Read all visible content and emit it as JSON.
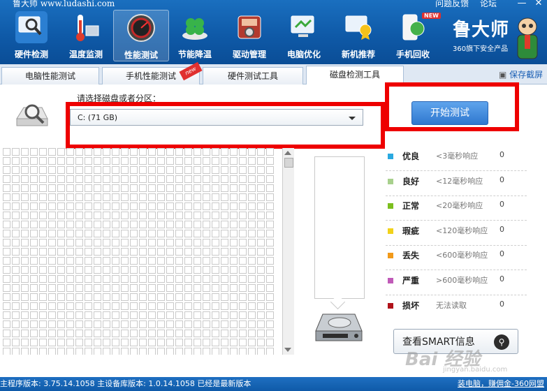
{
  "app": {
    "title": "鲁大师 www.ludashi.com",
    "top_links": [
      "问题反馈",
      "论坛"
    ],
    "window_controls": [
      "minimize",
      "close"
    ]
  },
  "nav": {
    "items": [
      {
        "label": "硬件检测",
        "icon": "monitor-magnifier-icon",
        "active": false
      },
      {
        "label": "温度监测",
        "icon": "thermometer-icon",
        "active": false
      },
      {
        "label": "性能测试",
        "icon": "speedometer-icon",
        "active": true
      },
      {
        "label": "节能降温",
        "icon": "clover-icon",
        "active": false
      },
      {
        "label": "驱动管理",
        "icon": "driver-gear-icon",
        "active": false
      },
      {
        "label": "电脑优化",
        "icon": "pc-optimize-icon",
        "active": false
      },
      {
        "label": "新机推荐",
        "icon": "award-pc-icon",
        "active": false
      },
      {
        "label": "手机回收",
        "icon": "phone-recycle-icon",
        "active": false,
        "badge": "NEW"
      }
    ],
    "brand_name": "鲁大师",
    "brand_sub": "360旗下安全产品"
  },
  "tabs": {
    "items": [
      "电脑性能测试",
      "手机性能测试",
      "硬件测试工具",
      "磁盘检测工具"
    ],
    "active_index": 3,
    "new_badge": "new",
    "save_screenshot": "保存截屏"
  },
  "disk_tool": {
    "select_label": "请选择磁盘或者分区：",
    "selected_drive": "C:  (71 GB)",
    "start_button": "开始测试",
    "legend": [
      {
        "name": "优良",
        "desc": "<3毫秒响应",
        "count": "0",
        "color": "#2aa9e0"
      },
      {
        "name": "良好",
        "desc": "<12毫秒响应",
        "count": "0",
        "color": "#a8d08d"
      },
      {
        "name": "正常",
        "desc": "<20毫秒响应",
        "count": "0",
        "color": "#7cbf1e"
      },
      {
        "name": "瑕疵",
        "desc": "<120毫秒响应",
        "count": "0",
        "color": "#f2d21a"
      },
      {
        "name": "丢失",
        "desc": "<600毫秒响应",
        "count": "0",
        "color": "#f29a1a"
      },
      {
        "name": "严重",
        "desc": ">600毫秒响应",
        "count": "0",
        "color": "#c05ab8"
      },
      {
        "name": "损坏",
        "desc": "无法读取",
        "count": "0",
        "color": "#b0121a"
      }
    ],
    "smart_button": "查看SMART信息"
  },
  "watermark": {
    "text": "Bai 经验",
    "url": "jingyan.baidu.com"
  },
  "statusbar": {
    "left": "主程序版本: 3.75.14.1058   主设备库版本: 1.0.14.1058   已经是最新版本",
    "right": "装电脑，赚佣金-360网盟"
  },
  "colors": {
    "header_blue": "#0f5aa8",
    "highlight_red": "#ee0000",
    "start_button_blue": "#2f78cf"
  }
}
